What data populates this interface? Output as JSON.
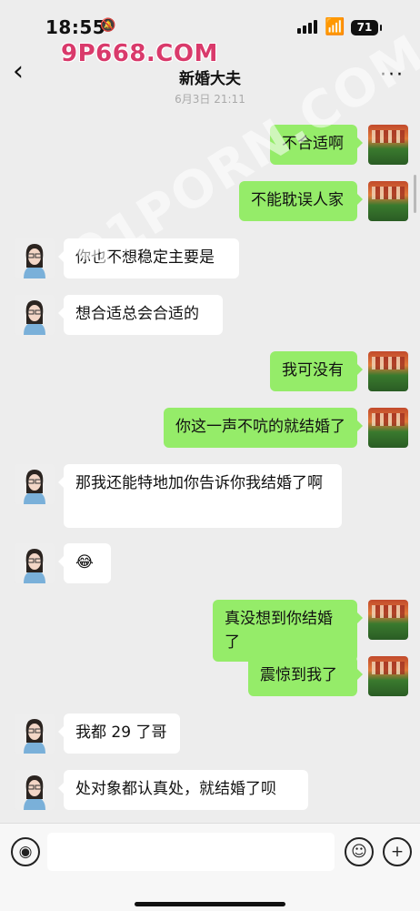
{
  "status_bar": {
    "time": "18:55",
    "battery": "71"
  },
  "watermark": {
    "top": "9P668.COM",
    "diagonal": "91PORN.COM"
  },
  "nav": {
    "title": "新婚大夫"
  },
  "timestamp": "6月3日 21:11",
  "messages": [
    {
      "side": "right",
      "text": "不合适啊"
    },
    {
      "side": "right",
      "text": "不能耽误人家"
    },
    {
      "side": "left",
      "text": "你也不想稳定主要是"
    },
    {
      "side": "left",
      "text": "想合适总会合适的"
    },
    {
      "side": "right",
      "text": "我可没有"
    },
    {
      "side": "right",
      "text": "你这一声不吭的就结婚了"
    },
    {
      "side": "left",
      "text": "那我还能特地加你告诉你我结婚了啊"
    },
    {
      "side": "left",
      "text": "😂"
    },
    {
      "side": "right",
      "text": "真没想到你结婚了"
    },
    {
      "side": "right",
      "text": "震惊到我了"
    },
    {
      "side": "left",
      "text": "我都 29 了哥"
    },
    {
      "side": "left",
      "text": "处对象都认真处，就结婚了呗"
    }
  ],
  "input_bar": {
    "text": ""
  },
  "icons": {
    "back": "chevron-left-icon",
    "more": "more-icon",
    "voice": "voice-icon",
    "emoji": "emoji-icon",
    "add": "plus-icon"
  }
}
